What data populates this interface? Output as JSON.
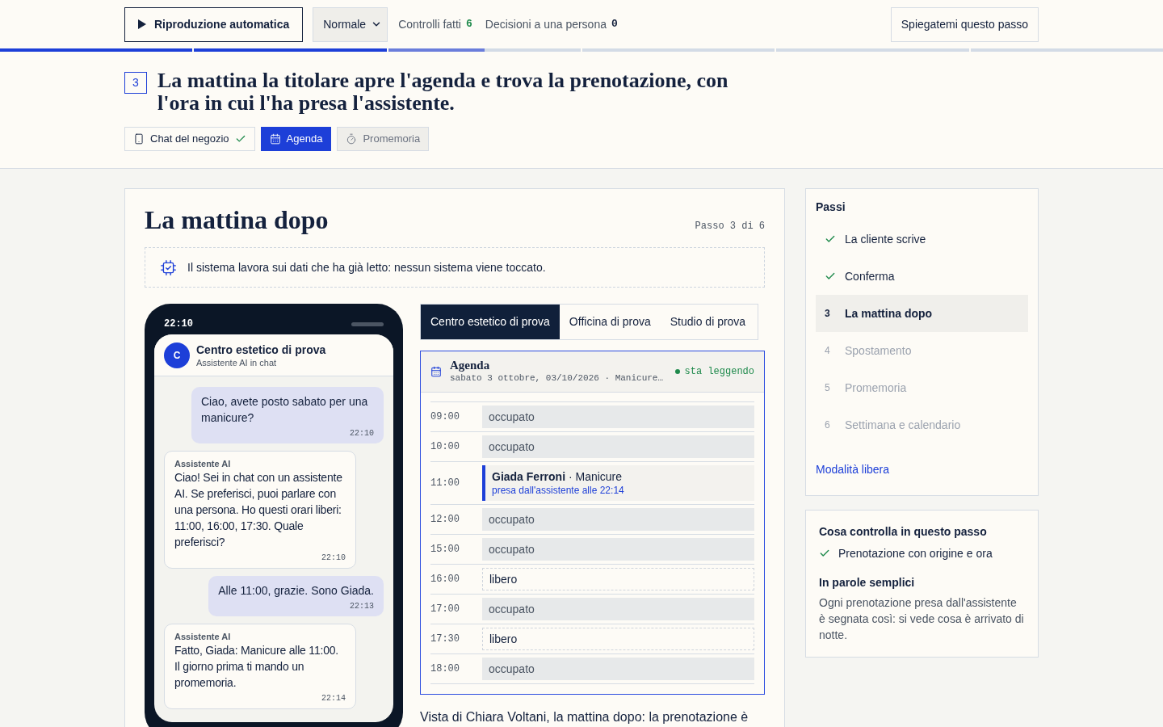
{
  "toolbar": {
    "autoplay_button": "Riproduzione automatica",
    "speed_select": "Normale",
    "stats": [
      {
        "label": "Controlli fatti",
        "value": "6",
        "kind": "positive"
      },
      {
        "label": "Decisioni a una persona",
        "value": "0",
        "kind": "neutral"
      }
    ],
    "explain_button": "Spiegatemi questo passo"
  },
  "progress": [
    {
      "level": 1
    },
    {
      "level": 1
    },
    {
      "level": 0.5
    },
    {
      "level": 0
    },
    {
      "level": 0
    },
    {
      "level": 0
    }
  ],
  "step": {
    "number": "3",
    "title": "La mattina la titolare apre l'agenda e trova la prenotazione, con l'ora in cui l'ha presa l'assistente.",
    "views": [
      {
        "kind": "chat",
        "label": "Chat del negozio",
        "selected": false,
        "done": true,
        "disabled": false
      },
      {
        "kind": "agenda",
        "label": "Agenda",
        "selected": true,
        "done": false,
        "disabled": false
      },
      {
        "kind": "reminder",
        "label": "Promemoria",
        "selected": false,
        "done": false,
        "disabled": true
      }
    ]
  },
  "scene": {
    "title": "La mattina dopo",
    "counter": "Passo 3 di 6",
    "notice": "Il sistema lavora sui dati che ha già letto: nessun sistema viene toccato.",
    "phone": {
      "clock": "22:10",
      "contact_initial": "C",
      "contact_name": "Centro estetico di prova",
      "contact_subtitle": "Assistente AI in chat",
      "messages": [
        {
          "kind": "outgoing",
          "text": "Ciao, avete posto sabato per una manicure?",
          "time": "22:10"
        },
        {
          "kind": "incoming",
          "sender": "Assistente AI",
          "text": "Ciao! Sei in chat con un assistente AI. Se preferisci, puoi parlare con una persona. Ho questi orari liberi: 11:00, 16:00, 17:30. Quale preferisci?",
          "time": "22:10"
        },
        {
          "kind": "outgoing",
          "text": "Alle 11:00, grazie. Sono Giada.",
          "time": "22:13"
        },
        {
          "kind": "incoming",
          "sender": "Assistente AI",
          "text": "Fatto, Giada: Manicure alle 11:00. Il giorno prima ti mando un promemoria.",
          "time": "22:14"
        }
      ]
    },
    "business_tabs": [
      {
        "label": "Centro estetico di prova",
        "selected": true
      },
      {
        "label": "Officina di prova",
        "selected": false
      },
      {
        "label": "Studio di prova",
        "selected": false
      }
    ],
    "agenda": {
      "title": "Agenda",
      "subtitle": "sabato 3 ottobre, 03/10/2026 · Manicure…",
      "status": "sta leggendo",
      "slots": [
        {
          "time": "09:00",
          "kind": "busy",
          "label": "occupato"
        },
        {
          "time": "10:00",
          "kind": "busy",
          "label": "occupato"
        },
        {
          "time": "11:00",
          "kind": "booking",
          "label": "**Giada Ferroni** · Manicure",
          "note": "presa dall'assistente alle 22:14"
        },
        {
          "time": "12:00",
          "kind": "busy",
          "label": "occupato"
        },
        {
          "time": "15:00",
          "kind": "busy",
          "label": "occupato"
        },
        {
          "time": "16:00",
          "kind": "free",
          "label": "libero"
        },
        {
          "time": "17:00",
          "kind": "busy",
          "label": "occupato"
        },
        {
          "time": "17:30",
          "kind": "free",
          "label": "libero"
        },
        {
          "time": "18:00",
          "kind": "busy",
          "label": "occupato"
        }
      ]
    },
    "caption": "Vista di Chiara Voltani, la mattina dopo: la prenotazione è"
  },
  "sidebar": {
    "steps_title": "Passi",
    "steps": [
      {
        "label": "La cliente scrive",
        "done": true,
        "selected": false
      },
      {
        "label": "Conferma",
        "done": true,
        "selected": false
      },
      {
        "number": "3",
        "label": "La mattina dopo",
        "done": false,
        "selected": true
      },
      {
        "number": "4",
        "label": "Spostamento",
        "done": false,
        "selected": false
      },
      {
        "number": "5",
        "label": "Promemoria",
        "done": false,
        "selected": false
      },
      {
        "number": "6",
        "label": "Settimana e calendario",
        "done": false,
        "selected": false
      }
    ],
    "free_mode_link": "Modalità libera",
    "checks": {
      "title": "Cosa controlla in questo passo",
      "items": [
        {
          "label": "Prenotazione con origine e ora",
          "passed": true
        }
      ],
      "plain_title": "In parole semplici",
      "plain_text": "Ogni prenotazione presa dall'assistente è segnata così: si vede cosa è arrivato di notte."
    }
  }
}
